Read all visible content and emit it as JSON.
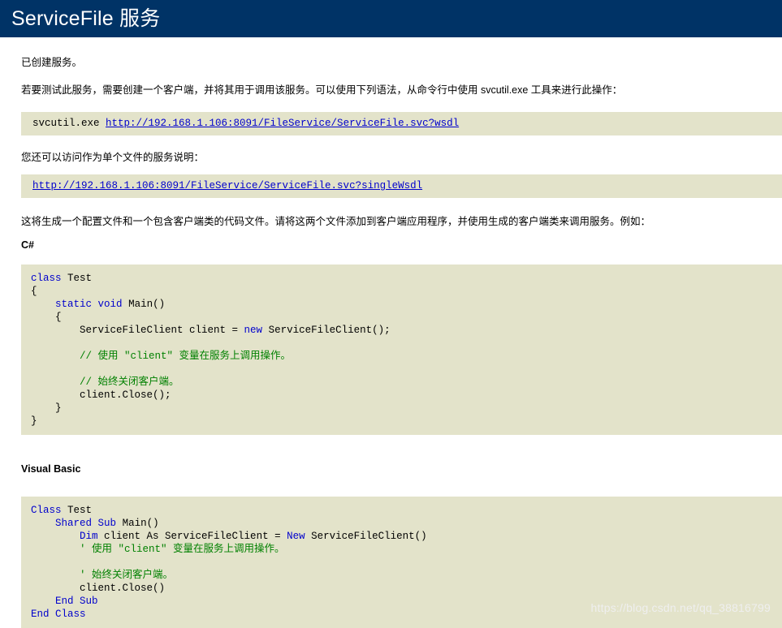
{
  "header": {
    "title": "ServiceFile 服务",
    "background_color": "#003366",
    "text_color": "#ffffff"
  },
  "colors": {
    "code_background": "#E3E3CA",
    "keyword": "#0000cc",
    "comment": "#008000",
    "link": "#0000cc",
    "page_background": "#ffffff"
  },
  "body": {
    "created_notice": "已创建服务。",
    "test_instructions": "若要测试此服务，需要创建一个客户端，并将其用于调用该服务。可以使用下列语法，从命令行中使用 svcutil.exe 工具来进行此操作：",
    "svcutil": {
      "command": "svcutil.exe ",
      "url": "http://192.168.1.106:8091/FileService/ServiceFile.svc?wsdl"
    },
    "single_file_notice": "您还可以访问作为单个文件的服务说明：",
    "single_wsdl_url": "http://192.168.1.106:8091/FileService/ServiceFile.svc?singleWsdl",
    "generation_notice": "这将生成一个配置文件和一个包含客户端类的代码文件。请将这两个文件添加到客户端应用程序，并使用生成的客户端类来调用服务。例如："
  },
  "csharp": {
    "heading": "C#",
    "lines": [
      [
        {
          "t": "class",
          "c": "kw"
        },
        {
          "t": " Test",
          "c": ""
        }
      ],
      [
        {
          "t": "{",
          "c": ""
        }
      ],
      [
        {
          "t": "    ",
          "c": ""
        },
        {
          "t": "static",
          "c": "kw"
        },
        {
          "t": " ",
          "c": ""
        },
        {
          "t": "void",
          "c": "kw"
        },
        {
          "t": " Main()",
          "c": ""
        }
      ],
      [
        {
          "t": "    {",
          "c": ""
        }
      ],
      [
        {
          "t": "        ServiceFileClient client = ",
          "c": ""
        },
        {
          "t": "new",
          "c": "kw"
        },
        {
          "t": " ServiceFileClient();",
          "c": ""
        }
      ],
      [
        {
          "t": "",
          "c": ""
        }
      ],
      [
        {
          "t": "        // 使用 \"client\" 变量在服务上调用操作。",
          "c": "cmt"
        }
      ],
      [
        {
          "t": "",
          "c": ""
        }
      ],
      [
        {
          "t": "        // 始终关闭客户端。",
          "c": "cmt"
        }
      ],
      [
        {
          "t": "        client.Close();",
          "c": ""
        }
      ],
      [
        {
          "t": "    }",
          "c": ""
        }
      ],
      [
        {
          "t": "}",
          "c": ""
        }
      ]
    ]
  },
  "visualbasic": {
    "heading": "Visual Basic",
    "lines": [
      [
        {
          "t": "Class",
          "c": "kw"
        },
        {
          "t": " Test",
          "c": ""
        }
      ],
      [
        {
          "t": "    ",
          "c": ""
        },
        {
          "t": "Shared",
          "c": "kw"
        },
        {
          "t": " ",
          "c": ""
        },
        {
          "t": "Sub",
          "c": "kw"
        },
        {
          "t": " Main()",
          "c": ""
        }
      ],
      [
        {
          "t": "        ",
          "c": ""
        },
        {
          "t": "Dim",
          "c": "kw"
        },
        {
          "t": " client As ServiceFileClient = ",
          "c": ""
        },
        {
          "t": "New",
          "c": "kw"
        },
        {
          "t": " ServiceFileClient()",
          "c": ""
        }
      ],
      [
        {
          "t": "        ' 使用 \"client\" 变量在服务上调用操作。",
          "c": "cmt"
        }
      ],
      [
        {
          "t": "",
          "c": ""
        }
      ],
      [
        {
          "t": "        ' 始终关闭客户端。",
          "c": "cmt"
        }
      ],
      [
        {
          "t": "        client.Close()",
          "c": ""
        }
      ],
      [
        {
          "t": "    ",
          "c": ""
        },
        {
          "t": "End",
          "c": "kw"
        },
        {
          "t": " ",
          "c": ""
        },
        {
          "t": "Sub",
          "c": "kw"
        }
      ],
      [
        {
          "t": "End",
          "c": "kw"
        },
        {
          "t": " ",
          "c": ""
        },
        {
          "t": "Class",
          "c": "kw"
        }
      ]
    ]
  },
  "watermark": {
    "text": "https://blog.csdn.net/qq_38816799"
  }
}
